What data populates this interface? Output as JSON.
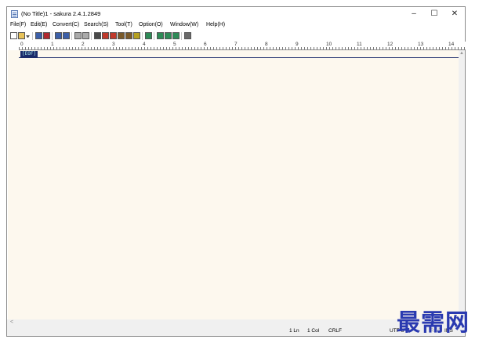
{
  "window": {
    "title": "(No Title)1 - sakura 2.4.1.2849",
    "min_glyph": "–",
    "max_glyph": "☐",
    "close_glyph": "✕"
  },
  "menu": {
    "items": [
      "File(F)",
      "Edit(E)",
      "Convert(C)",
      "Search(S)",
      "Tool(T)",
      "Option(O)",
      "Window(W)",
      "Help(H)"
    ]
  },
  "toolbar": {
    "buttons": [
      {
        "name": "new-file-icon",
        "color": "#ffffff"
      },
      {
        "name": "open-file-icon",
        "color": "#e8c35a"
      },
      {
        "name": "dropdown-arrow-icon",
        "color": "#555555"
      },
      {
        "name": "save-icon",
        "color": "#3c5fa8"
      },
      {
        "name": "save-all-icon",
        "color": "#b0282e"
      },
      {
        "name": "undo-icon",
        "color": "#3c5fa8"
      },
      {
        "name": "redo-icon",
        "color": "#3c5fa8"
      },
      {
        "name": "jump-back-icon",
        "color": "#aaaaaa"
      },
      {
        "name": "jump-forward-icon",
        "color": "#aaaaaa"
      },
      {
        "name": "search-icon",
        "color": "#4a4a4a"
      },
      {
        "name": "search-prev-icon",
        "color": "#c0392b"
      },
      {
        "name": "search-next-icon",
        "color": "#c0392b"
      },
      {
        "name": "replace-icon",
        "color": "#7a5a2a"
      },
      {
        "name": "grep-icon",
        "color": "#7a5a2a"
      },
      {
        "name": "bookmark-icon",
        "color": "#b5a020"
      },
      {
        "name": "compare-icon",
        "color": "#2e8b57"
      },
      {
        "name": "outline-icon",
        "color": "#2e8b57"
      },
      {
        "name": "tag-jump-icon",
        "color": "#2e8b57"
      },
      {
        "name": "tag-jump-back-icon",
        "color": "#2e8b57"
      },
      {
        "name": "settings-icon",
        "color": "#6a6a6a"
      }
    ]
  },
  "ruler": {
    "labels": [
      "0",
      "1",
      "2",
      "3",
      "4",
      "5",
      "6",
      "7",
      "8",
      "9",
      "10",
      "11",
      "12",
      "13",
      "14"
    ]
  },
  "editor": {
    "eof": "[EOF]",
    "background": "#fdf8ee"
  },
  "status": {
    "line": "1 Ln",
    "col": "1 Col",
    "eol": "CRLF",
    "encoding": "UTF-8",
    "rec": "REC",
    "ins": "INS"
  },
  "watermark": {
    "text": "最需网",
    "color": "#2a3ab0"
  }
}
